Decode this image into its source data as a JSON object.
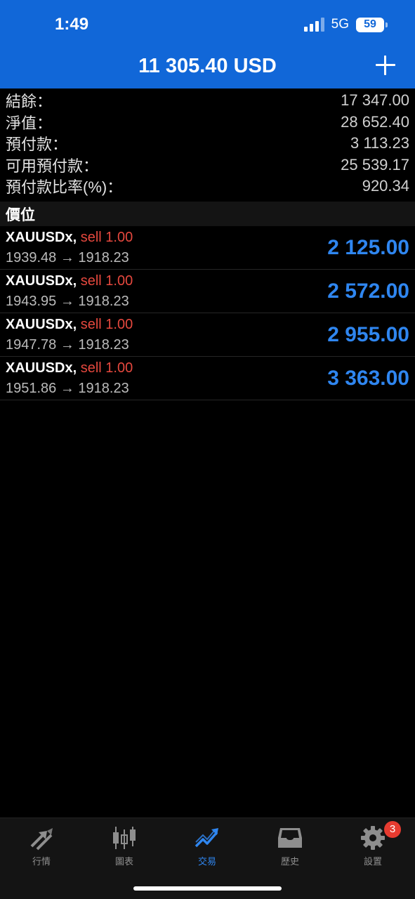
{
  "status_bar": {
    "time": "1:49",
    "network": "5G",
    "battery": "59"
  },
  "header": {
    "balance_title": "11 305.40 USD"
  },
  "summary": [
    {
      "label": "結餘：",
      "value": "17 347.00"
    },
    {
      "label": "淨值：",
      "value": "28 652.40"
    },
    {
      "label": "預付款：",
      "value": "3 113.23"
    },
    {
      "label": "可用預付款：",
      "value": "25 539.17"
    },
    {
      "label": "預付款比率(%)：",
      "value": "920.34"
    }
  ],
  "positions_section": {
    "title": "價位"
  },
  "positions": [
    {
      "symbol": "XAUUSDx,",
      "side": "sell 1.00",
      "prices": "1939.48 → 1918.23",
      "profit": "2 125.00"
    },
    {
      "symbol": "XAUUSDx,",
      "side": "sell 1.00",
      "prices": "1943.95 → 1918.23",
      "profit": "2 572.00"
    },
    {
      "symbol": "XAUUSDx,",
      "side": "sell 1.00",
      "prices": "1947.78 → 1918.23",
      "profit": "2 955.00"
    },
    {
      "symbol": "XAUUSDx,",
      "side": "sell 1.00",
      "prices": "1951.86 → 1918.23",
      "profit": "3 363.00"
    }
  ],
  "tabbar": {
    "tabs": [
      {
        "label": "行情",
        "icon": "quotes-arrows-icon",
        "active": false
      },
      {
        "label": "圖表",
        "icon": "candlestick-chart-icon",
        "active": false
      },
      {
        "label": "交易",
        "icon": "trade-trend-icon",
        "active": true
      },
      {
        "label": "歷史",
        "icon": "history-inbox-icon",
        "active": false
      },
      {
        "label": "設置",
        "icon": "gear-icon",
        "active": false
      }
    ],
    "settings_badge": "3"
  },
  "colors": {
    "header_bg": "#1167d8",
    "accent_blue": "#2f86f0",
    "sell_red": "#e5483e",
    "badge_red": "#e63b30"
  }
}
